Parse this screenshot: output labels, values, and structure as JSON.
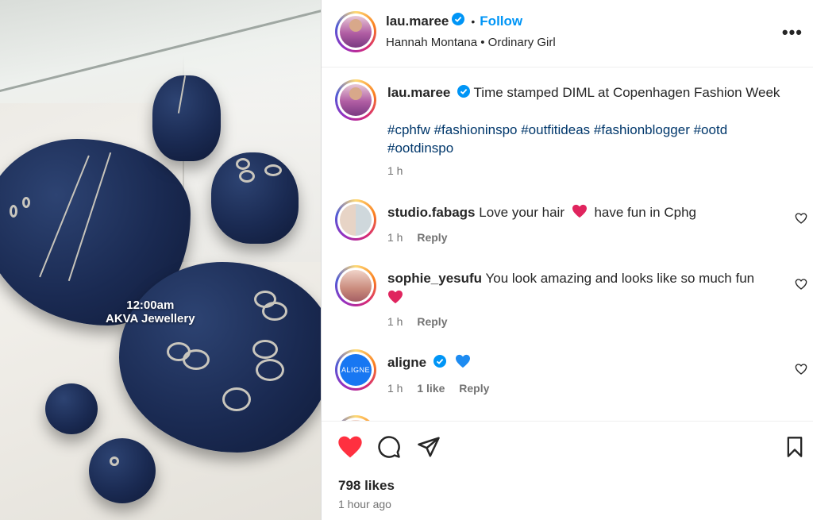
{
  "photo": {
    "caption_time": "12:00am",
    "caption_brand": "AKVA Jewellery"
  },
  "header": {
    "username": "lau.maree",
    "follow_label": "Follow",
    "audio_label": "Hannah Montana • Ordinary Girl",
    "more_icon": "more-horizontal-icon"
  },
  "post": {
    "username": "lau.maree",
    "caption": "Time stamped DIML at Copenhagen Fashion Week",
    "hashtags_line1": "#cphfw #fashioninspo #outfitideas #fashionblogger #ootd",
    "hashtags_line2": "#ootdinspo",
    "time": "1 h"
  },
  "comments": [
    {
      "username": "studio.fabags",
      "text_before": "Love your hair",
      "text_after": "have fun in Cphg",
      "time": "1 h",
      "reply": "Reply"
    },
    {
      "username": "sophie_yesufu",
      "text": "You look amazing and looks like so much fun",
      "time": "1 h",
      "reply": "Reply"
    },
    {
      "username": "aligne",
      "avatar_text": "ALIGNE",
      "time": "1 h",
      "likes": "1 like",
      "reply": "Reply"
    }
  ],
  "footer": {
    "likes": "798 likes",
    "time_ago": "1 hour ago"
  },
  "colors": {
    "link_blue": "#0095f6",
    "hashtag": "#00376b",
    "like_red": "#ff3040",
    "verified": "#0095f6",
    "muted": "#737373"
  }
}
